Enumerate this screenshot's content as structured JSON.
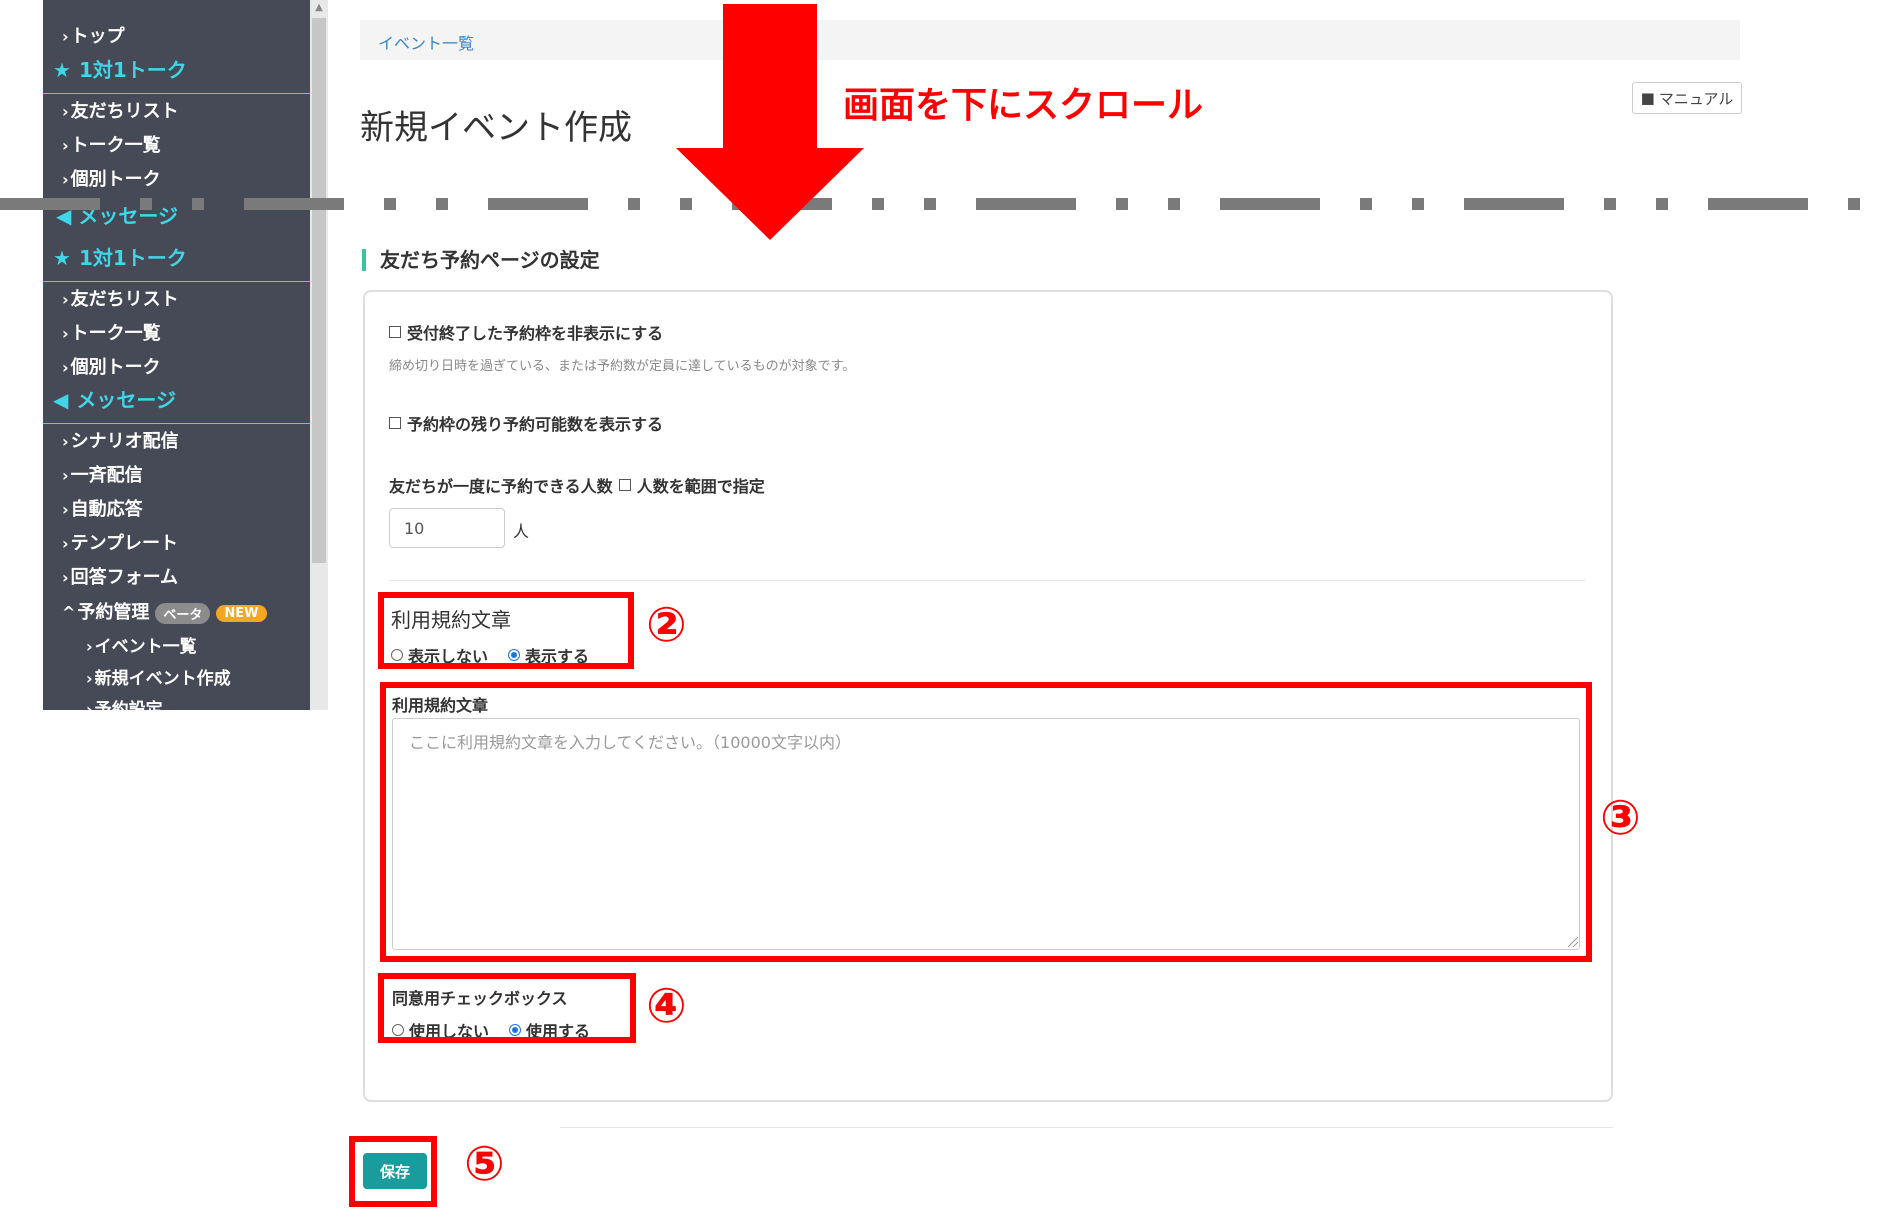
{
  "sidebar": {
    "top_items": [
      "トップ"
    ],
    "section1_title": "1対1トーク",
    "section1_items": [
      "友だちリスト",
      "トーク一覧",
      "個別トーク"
    ],
    "section2_title": "メッセージ",
    "section2_items": [
      "シナリオ配信",
      "一斉配信",
      "自動応答",
      "テンプレート",
      "回答フォーム"
    ],
    "reserve": {
      "label": "予約管理",
      "badge_beta": "ベータ",
      "badge_new": "NEW"
    },
    "reserve_items": [
      "イベント一覧",
      "新規イベント作成",
      "予約設定"
    ]
  },
  "breadcrumb": {
    "item": "イベント一覧"
  },
  "page": {
    "title": "新規イベント作成",
    "manual_label": "マニュアル"
  },
  "annotation": {
    "scroll_text": "画面を下にスクロール",
    "n2": "②",
    "n3": "③",
    "n4": "④",
    "n5": "⑤"
  },
  "form": {
    "section_title": "友だち予約ページの設定",
    "hide_closed_label": "受付終了した予約枠を非表示にする",
    "hide_closed_hint": "締め切り日時を過ぎている、または予約数が定員に達しているものが対象です。",
    "show_remaining_label": "予約枠の残り予約可能数を表示する",
    "people_label": "友だちが一度に予約できる人数",
    "range_label": "人数を範囲で指定",
    "people_value": "10",
    "people_unit": "人",
    "terms_toggle_label": "利用規約文章",
    "terms_opt_hide": "表示しない",
    "terms_opt_show": "表示する",
    "terms_text_label": "利用規約文章",
    "terms_placeholder": "ここに利用規約文章を入力してください。（10000文字以内）",
    "agree_label": "同意用チェックボックス",
    "agree_opt_no": "使用しない",
    "agree_opt_yes": "使用する",
    "save_label": "保存"
  },
  "colors": {
    "sidebar_bg": "#464a56",
    "sidebar_accent": "#3fd6e8",
    "annotation_red": "#ff0000",
    "save_btn": "#1a9c9c",
    "section_bar": "#3cc39a"
  }
}
